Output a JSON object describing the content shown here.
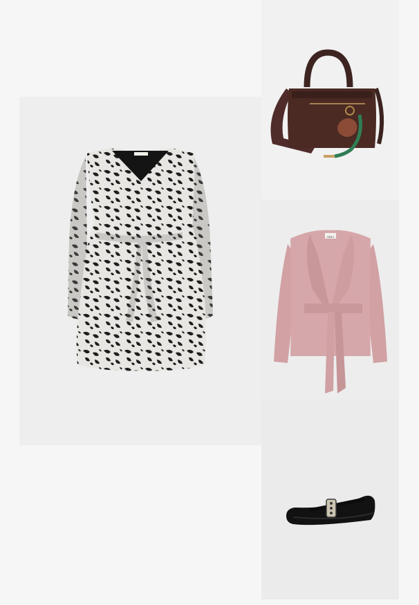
{
  "outfit": {
    "items": [
      {
        "id": "dress",
        "type": "dress",
        "pattern": "animal-print",
        "colors": [
          "#1c1c1c",
          "#e6e6e2"
        ]
      },
      {
        "id": "bag",
        "type": "handbag",
        "colors": [
          "#4a2a23",
          "#2f7d55"
        ]
      },
      {
        "id": "coat",
        "type": "wrap-jacket",
        "colors": [
          "#d3a3a6"
        ]
      },
      {
        "id": "shoe",
        "type": "ballet-flat",
        "colors": [
          "#111111",
          "#c9c3b3"
        ]
      }
    ],
    "label_text": "ONLY"
  }
}
